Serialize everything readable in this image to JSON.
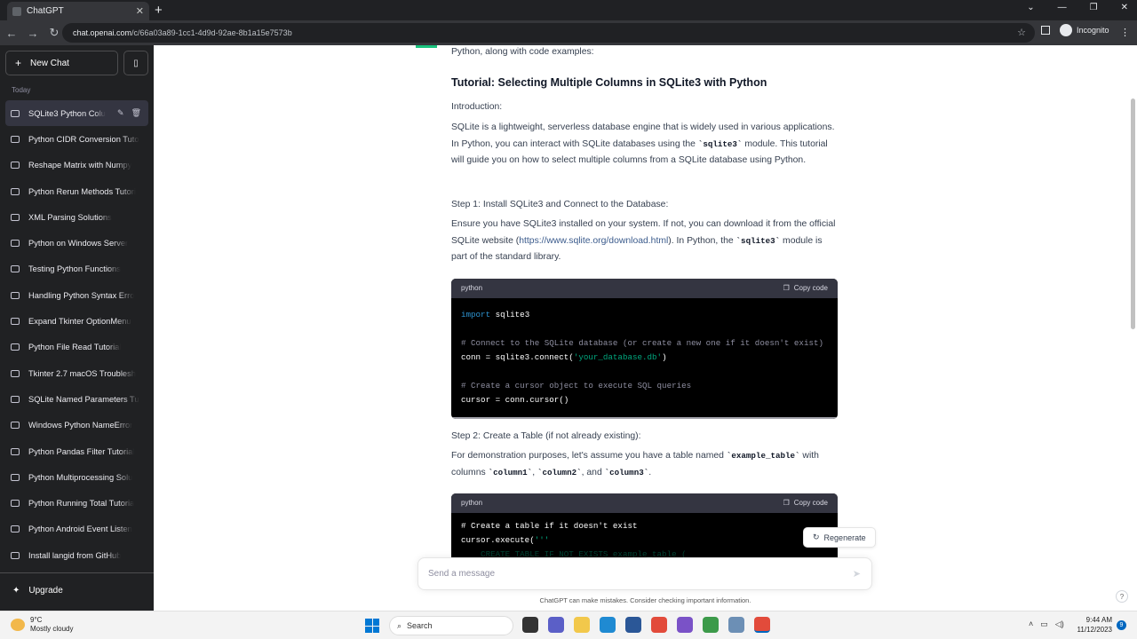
{
  "browser": {
    "tab_title": "ChatGPT",
    "url_host": "chat.openai.com",
    "url_path": "/c/66a03a89-1cc1-4d9d-92ae-8b1a15e7573b",
    "profile": "Incognito"
  },
  "sidebar": {
    "new_chat": "New Chat",
    "section": "Today",
    "items": [
      {
        "label": "SQLite3 Python Colu"
      },
      {
        "label": "Python CIDR Conversion Tuto"
      },
      {
        "label": "Reshape Matrix with Numpy"
      },
      {
        "label": "Python Rerun Methods Tutori"
      },
      {
        "label": "XML Parsing Solutions"
      },
      {
        "label": "Python on Windows Server"
      },
      {
        "label": "Testing Python Functions"
      },
      {
        "label": "Handling Python Syntax Erro"
      },
      {
        "label": "Expand Tkinter OptionMenu"
      },
      {
        "label": "Python File Read Tutorial"
      },
      {
        "label": "Tkinter 2.7 macOS Troublesh"
      },
      {
        "label": "SQLite Named Parameters Tu"
      },
      {
        "label": "Windows Python NameError"
      },
      {
        "label": "Python Pandas Filter Tutorial"
      },
      {
        "label": "Python Multiprocessing Solu"
      },
      {
        "label": "Python Running Total Tutoria"
      },
      {
        "label": "Python Android Event Listen"
      },
      {
        "label": "Install langid from GitHub"
      }
    ],
    "upgrade": "Upgrade"
  },
  "chat": {
    "intro_tail": "Python, along with code examples:",
    "heading": "Tutorial: Selecting Multiple Columns in SQLite3 with Python",
    "intro_label": "Introduction:",
    "p1_a": "SQLite is a lightweight, serverless database engine that is widely used in various applications. In Python, you can interact with SQLite databases using the ",
    "p1_code": "`sqlite3`",
    "p1_b": " module. This tutorial will guide you on how to select multiple columns from a SQLite database using Python.",
    "step1": "Step 1: Install SQLite3 and Connect to the Database:",
    "p2_a": "Ensure you have SQLite3 installed on your system. If not, you can download it from the official SQLite website (",
    "p2_link": "https://www.sqlite.org/download.html",
    "p2_b": "). In Python, the ",
    "p2_code": "`sqlite3`",
    "p2_c": " module is part of the standard library.",
    "code1": {
      "lang": "python",
      "copy": "Copy code",
      "l1_kw": "import",
      "l1_rest": " sqlite3",
      "l3": "# Connect to the SQLite database (or create a new one if it doesn't exist)",
      "l4_a": "conn = sqlite3.connect(",
      "l4_str": "'your_database.db'",
      "l4_b": ")",
      "l6": "# Create a cursor object to execute SQL queries",
      "l7": "cursor = conn.cursor()"
    },
    "step2": "Step 2: Create a Table (if not already existing):",
    "p3_a": "For demonstration purposes, let's assume you have a table named ",
    "p3_code1": "`example_table`",
    "p3_b": " with columns ",
    "p3_code2": "`column1`",
    "p3_c": ", ",
    "p3_code3": "`column2`",
    "p3_d": ", and ",
    "p3_code4": "`column3`",
    "p3_e": ".",
    "code2": {
      "lang": "python",
      "copy": "Copy code",
      "l1": "# Create a table if it doesn't exist",
      "l2_a": "cursor.execute(",
      "l2_str": "'''",
      "l3": "    CREATE TABLE IF NOT EXISTS example_table ("
    },
    "regenerate": "Regenerate",
    "input_placeholder": "Send a message",
    "disclaimer": "ChatGPT can make mistakes. Consider checking important information."
  },
  "taskbar": {
    "temp": "9°C",
    "weather": "Mostly cloudy",
    "search": "Search",
    "time": "9:44 AM",
    "date": "11/12/2023",
    "notifications": "9"
  }
}
